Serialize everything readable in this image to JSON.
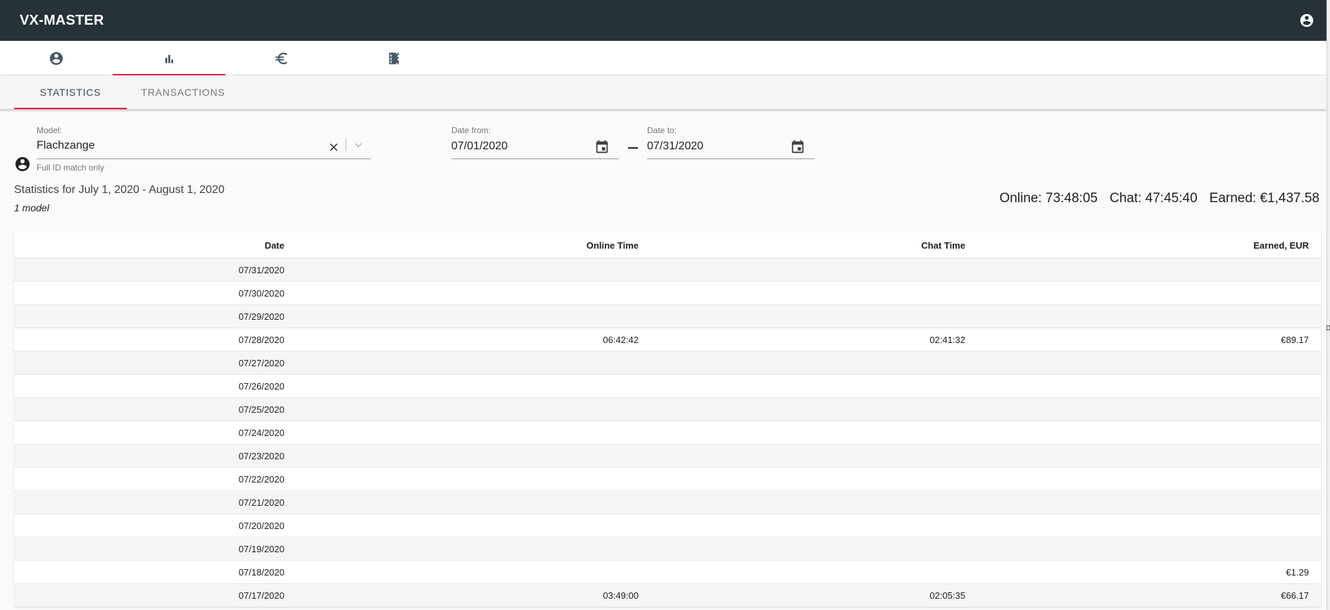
{
  "app": {
    "title": "VX-MASTER"
  },
  "icon_tabs": [
    {
      "icon": "account-circle-icon"
    },
    {
      "icon": "bar-chart-icon"
    },
    {
      "icon": "euro-icon"
    },
    {
      "icon": "movie-film-icon"
    }
  ],
  "sub_tabs": {
    "statistics": "STATISTICS",
    "transactions": "TRANSACTIONS"
  },
  "filters": {
    "model_label": "Model:",
    "model_value": "Flachzange",
    "model_hint": "Full ID match only",
    "date_from_label": "Date from:",
    "date_from_value": "07/01/2020",
    "date_to_label": "Date to:",
    "date_to_value": "07/31/2020"
  },
  "summary": {
    "title": "Statistics for July 1, 2020 - August 1, 2020",
    "model_count": "1 model",
    "online": "Online: 73:48:05",
    "chat": "Chat: 47:45:40",
    "earned": "Earned: €1,437.58"
  },
  "table": {
    "headers": {
      "date": "Date",
      "online": "Online Time",
      "chat": "Chat Time",
      "earned": "Earned, EUR"
    },
    "rows": [
      {
        "date": "07/31/2020",
        "online": "",
        "chat": "",
        "earned": ""
      },
      {
        "date": "07/30/2020",
        "online": "",
        "chat": "",
        "earned": ""
      },
      {
        "date": "07/29/2020",
        "online": "",
        "chat": "",
        "earned": ""
      },
      {
        "date": "07/28/2020",
        "online": "06:42:42",
        "chat": "02:41:32",
        "earned": "€89.17"
      },
      {
        "date": "07/27/2020",
        "online": "",
        "chat": "",
        "earned": ""
      },
      {
        "date": "07/26/2020",
        "online": "",
        "chat": "",
        "earned": ""
      },
      {
        "date": "07/25/2020",
        "online": "",
        "chat": "",
        "earned": ""
      },
      {
        "date": "07/24/2020",
        "online": "",
        "chat": "",
        "earned": ""
      },
      {
        "date": "07/23/2020",
        "online": "",
        "chat": "",
        "earned": ""
      },
      {
        "date": "07/22/2020",
        "online": "",
        "chat": "",
        "earned": ""
      },
      {
        "date": "07/21/2020",
        "online": "",
        "chat": "",
        "earned": ""
      },
      {
        "date": "07/20/2020",
        "online": "",
        "chat": "",
        "earned": ""
      },
      {
        "date": "07/19/2020",
        "online": "",
        "chat": "",
        "earned": ""
      },
      {
        "date": "07/18/2020",
        "online": "",
        "chat": "",
        "earned": "€1.29"
      },
      {
        "date": "07/17/2020",
        "online": "03:49:00",
        "chat": "02:05:35",
        "earned": "€66.17"
      }
    ]
  },
  "colors": {
    "appbar": "#263238",
    "accent": "#e31b4a"
  }
}
